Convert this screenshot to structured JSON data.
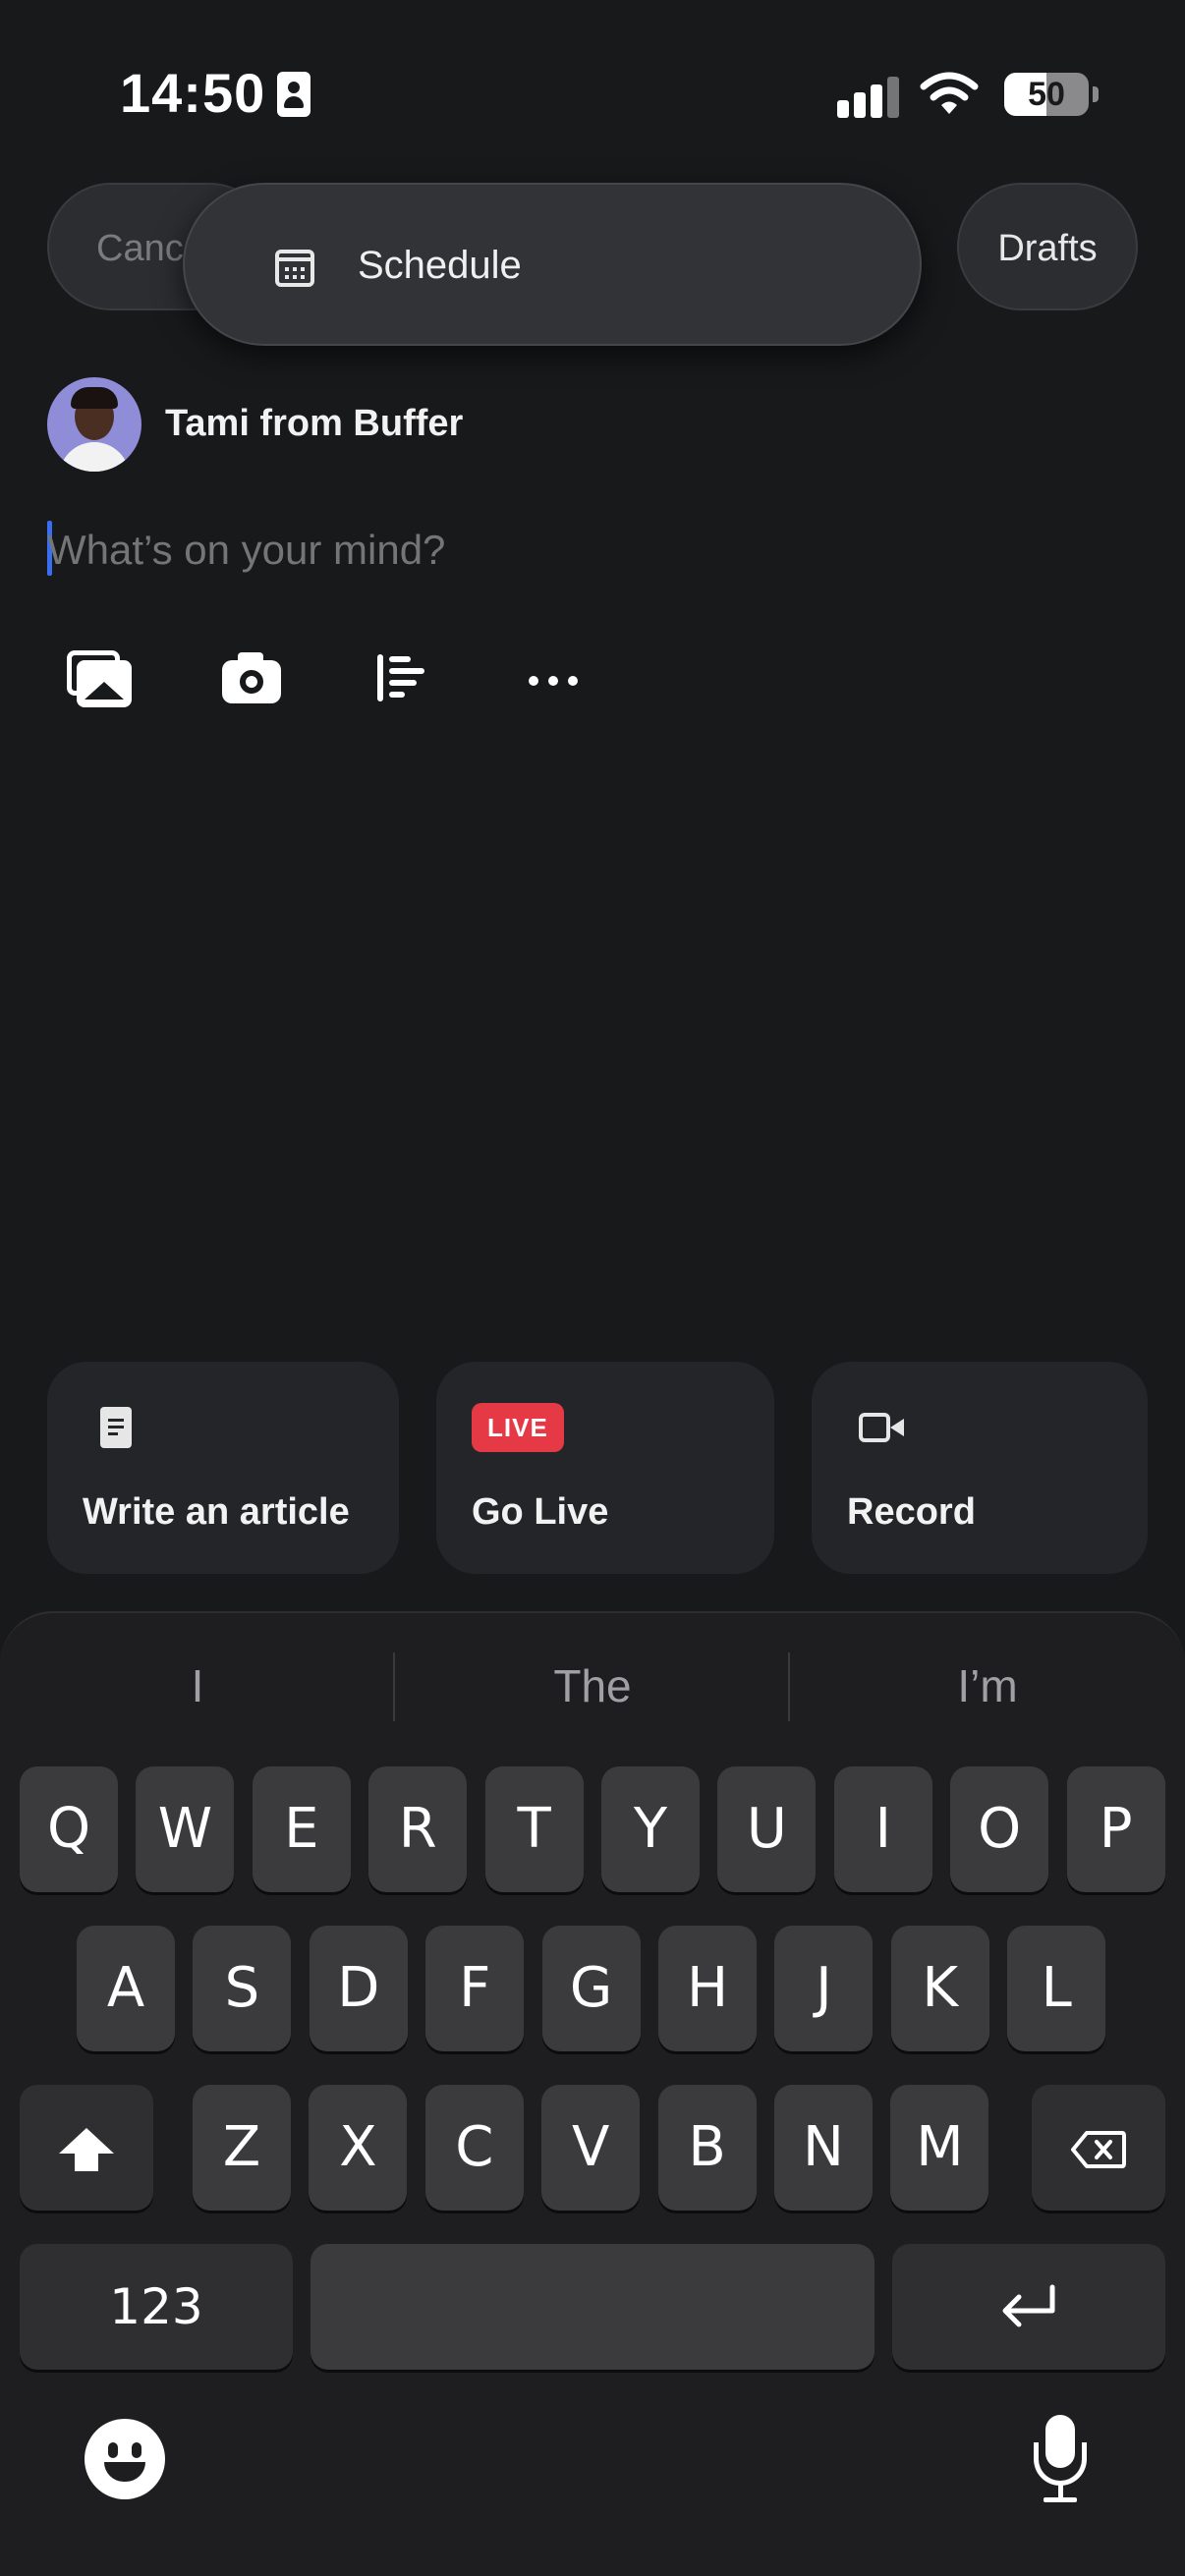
{
  "status_bar": {
    "time": "14:50",
    "battery": "50",
    "battery_level": 0.5
  },
  "header": {
    "cancel_label": "Canc",
    "schedule_label": "Schedule",
    "drafts_label": "Drafts"
  },
  "author": {
    "name": "Tami from Buffer"
  },
  "composer": {
    "placeholder": "What’s on your mind?",
    "value": ""
  },
  "toolbar": {
    "icons": [
      "photo-library-icon",
      "camera-icon",
      "list-icon",
      "more-icon"
    ]
  },
  "actions": {
    "article_label": "Write an article",
    "live_badge": "LIVE",
    "live_label": "Go Live",
    "record_label": "Record"
  },
  "keyboard": {
    "suggestions": [
      "I",
      "The",
      "I’m"
    ],
    "row1": [
      "Q",
      "W",
      "E",
      "R",
      "T",
      "Y",
      "U",
      "I",
      "O",
      "P"
    ],
    "row2": [
      "A",
      "S",
      "D",
      "F",
      "G",
      "H",
      "J",
      "K",
      "L"
    ],
    "row3": [
      "Z",
      "X",
      "C",
      "V",
      "B",
      "N",
      "M"
    ],
    "numbers_label": "123"
  },
  "colors": {
    "background": "#18191b",
    "live": "#e53946",
    "cursor": "#3a6ef0"
  }
}
